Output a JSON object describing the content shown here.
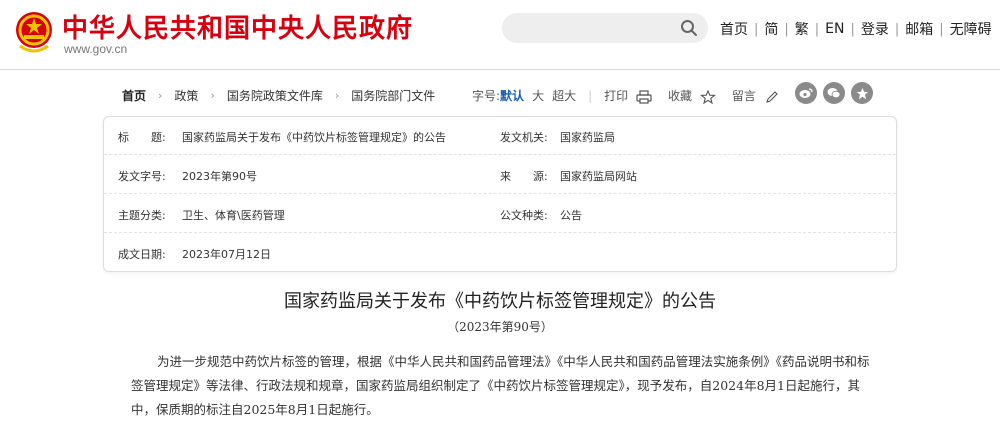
{
  "header": {
    "site_title": "中华人民共和国中央人民政府",
    "site_url": "www.gov.cn",
    "emblem_icon": "national-emblem-icon",
    "search": {
      "placeholder": "",
      "icon": "search-icon"
    },
    "nav": [
      "首页",
      "简",
      "繁",
      "EN",
      "登录",
      "邮箱",
      "无障碍"
    ]
  },
  "breadcrumb": [
    "首页",
    "政策",
    "国务院政策文件库",
    "国务院部门文件"
  ],
  "toolbar": {
    "font_size_label": "字号:",
    "font_sizes": [
      "默认",
      "大",
      "超大"
    ],
    "active_font_size": "默认",
    "print_label": "打印",
    "print_icon": "printer-icon",
    "favorite_label": "收藏",
    "favorite_icon": "star-outline-icon",
    "comment_label": "留言",
    "comment_icon": "pencil-icon",
    "share_icons": [
      "weibo-icon",
      "wechat-icon",
      "favorite-star-icon"
    ]
  },
  "meta": {
    "title_label": "标　　题:",
    "title_value": "国家药监局关于发布《中药饮片标签管理规定》的公告",
    "issuer_label": "发文机关:",
    "issuer_value": "国家药监局",
    "doc_no_label": "发文字号:",
    "doc_no_value": "2023年第90号",
    "source_label": "来　　源:",
    "source_value": "国家药监局网站",
    "category_label": "主题分类:",
    "category_value": "卫生、体育\\医药管理",
    "type_label": "公文种类:",
    "type_value": "公告",
    "date_label": "成文日期:",
    "date_value": "2023年07月12日"
  },
  "article": {
    "title": "国家药监局关于发布《中药饮片标签管理规定》的公告",
    "number": "（2023年第90号）",
    "body": "为进一步规范中药饮片标签的管理，根据《中华人民共和国药品管理法》《中华人民共和国药品管理法实施条例》《药品说明书和标签管理规定》等法律、行政法规和规章，国家药监局组织制定了《中药饮片标签管理规定》，现予发布，自2024年8月1日起施行，其中，保质期的标注自2025年8月1日起施行。"
  },
  "colors": {
    "brand_red": "#d7000f",
    "active_blue": "#1b5fb3",
    "share_gray": "#8a8a8a"
  }
}
